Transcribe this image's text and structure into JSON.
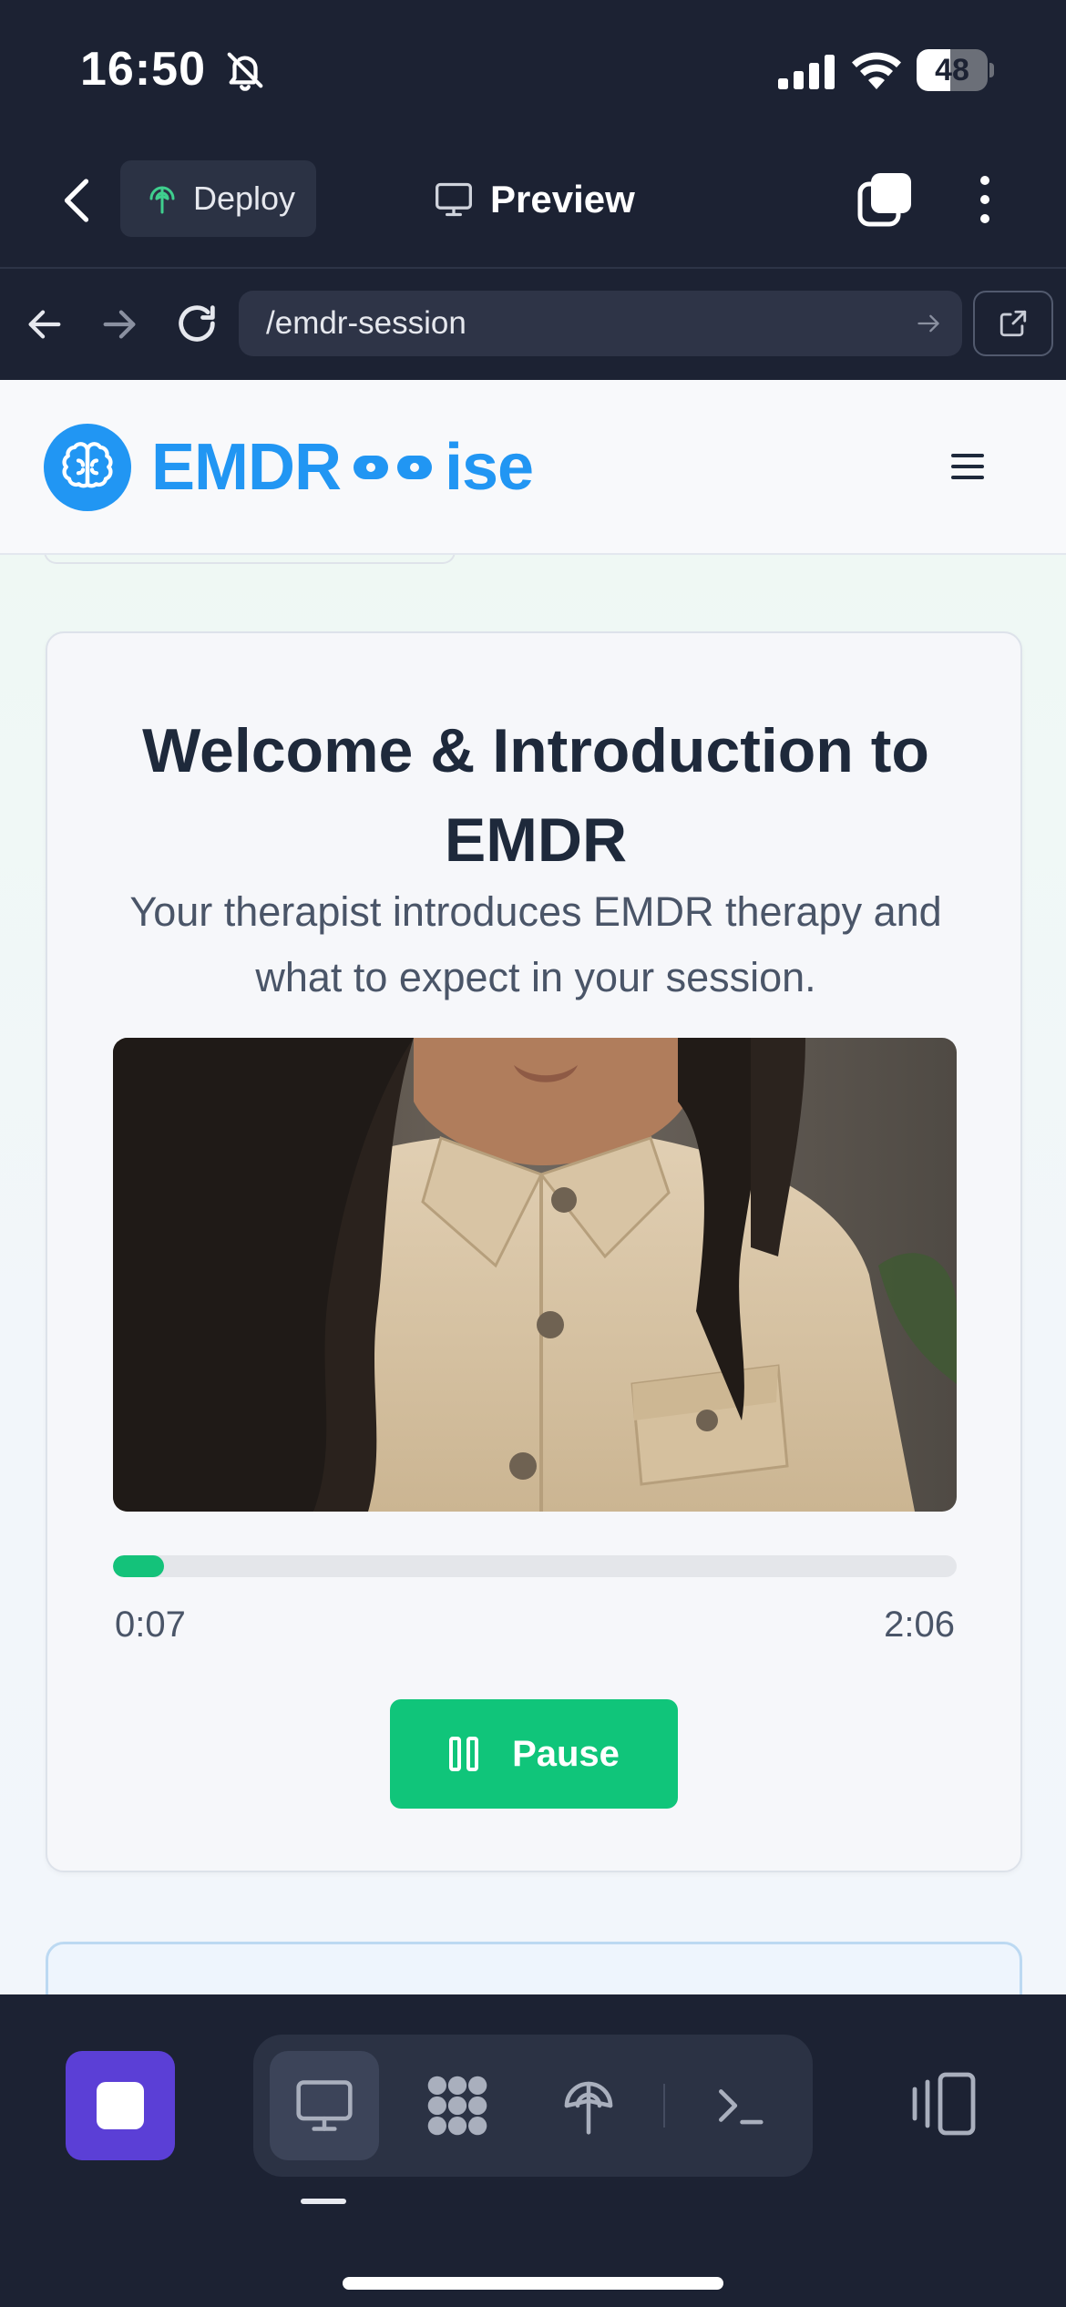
{
  "status_bar": {
    "time": "16:50",
    "battery": "48",
    "battery_level": 0.48
  },
  "app_header": {
    "deploy_label": "Deploy",
    "title": "Preview"
  },
  "browser": {
    "url": "/emdr-session"
  },
  "site": {
    "brand_part1": "EMDR",
    "brand_part2": "ise"
  },
  "session_card": {
    "title": "Welcome & Introduction to EMDR",
    "subtitle": "Your therapist introduces EMDR therapy and what to expect in your session.",
    "current_time": "0:07",
    "total_time": "2:06",
    "progress": 0.06,
    "pause_label": "Pause"
  },
  "colors": {
    "brand_blue": "#2196f3",
    "accent_green": "#10c57a",
    "stop_purple": "#5b3fd6",
    "chrome_dark": "#1c2233"
  },
  "toolbar": {
    "tools": [
      "preview-icon",
      "apps-icon",
      "deploy-icon",
      "terminal-icon"
    ]
  }
}
